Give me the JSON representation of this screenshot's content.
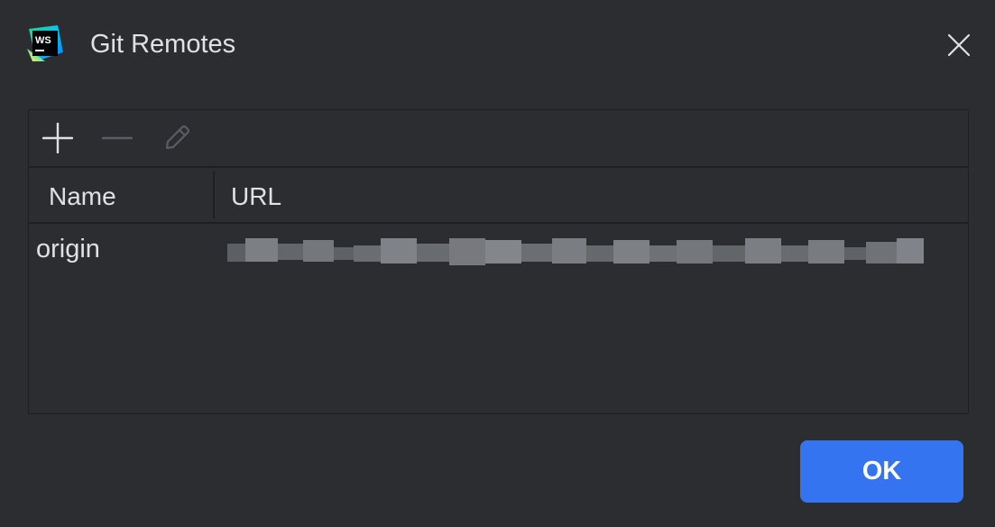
{
  "dialog": {
    "title": "Git Remotes",
    "app_logo_text": "WS",
    "close_icon": "close-icon"
  },
  "toolbar": {
    "add_icon": "plus-icon",
    "remove_icon": "minus-icon",
    "edit_icon": "pencil-icon"
  },
  "table": {
    "columns": [
      "Name",
      "URL"
    ],
    "rows": [
      {
        "name": "origin",
        "url": ""
      }
    ]
  },
  "footer": {
    "ok_label": "OK"
  },
  "colors": {
    "background": "#2b2d30",
    "border": "#1e1f22",
    "text": "#dfe1e5",
    "accent": "#3574f0",
    "icon_disabled": "#5a5d63"
  }
}
